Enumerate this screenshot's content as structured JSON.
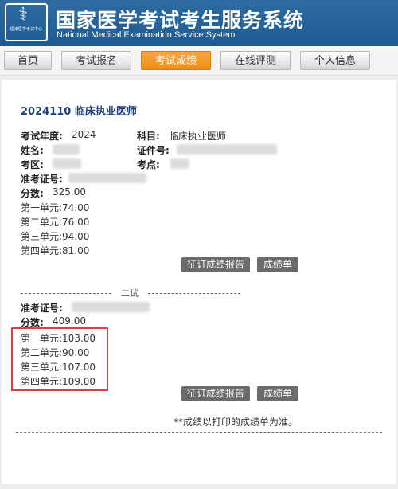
{
  "header": {
    "title": "国家医学考试考生服务系统",
    "subtitle": "National Medical Examination Service System",
    "logo_text": "国家医学考试中心"
  },
  "nav": {
    "items": [
      {
        "label": "首页"
      },
      {
        "label": "考试报名"
      },
      {
        "label": "考试成绩"
      },
      {
        "label": "在线评测"
      },
      {
        "label": "个人信息"
      }
    ],
    "active": "考试成绩"
  },
  "exam": {
    "title": "2024110  临床执业医师",
    "year_label": "考试年度:",
    "year": "2024",
    "subject_label": "科目:",
    "subject": "临床执业医师",
    "name_label": "姓名:",
    "id_label": "证件号:",
    "district_label": "考区:",
    "site_label": "考点:",
    "ticket_label": "准考证号:",
    "score_label": "分数:",
    "score": "325.00",
    "units": [
      "第一单元:74.00",
      "第二单元:76.00",
      "第三单元:94.00",
      "第四单元:81.00"
    ]
  },
  "second": {
    "label": "二试",
    "ticket_label": "准考证号:",
    "score_label": "分数:",
    "score": "409.00",
    "units": [
      "第一单元:103.00",
      "第二单元:90.00",
      "第三单元:107.00",
      "第四单元:109.00"
    ]
  },
  "buttons": {
    "report": "征订成绩报告",
    "transcript": "成绩单"
  },
  "footer_note": "**成绩以打印的成绩单为准。"
}
